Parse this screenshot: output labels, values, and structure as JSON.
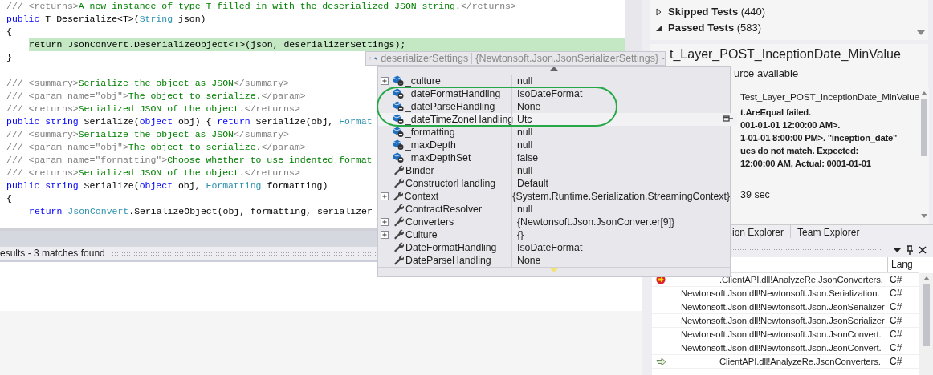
{
  "editor": {
    "blocks": [
      [
        {
          "indented": false,
          "highlight": false,
          "tokens": [
            {
              "kind": "doc",
              "text": "/// <returns>"
            },
            {
              "kind": "doc-text",
              "text": "A new instance of type T filled in with the deserialized JSON string."
            },
            {
              "kind": "doc",
              "text": "</returns>"
            }
          ]
        },
        {
          "indented": false,
          "highlight": false,
          "tokens": [
            {
              "kind": "kw",
              "text": "public"
            },
            {
              "kind": "text",
              "text": " T Deserialize<T>("
            },
            {
              "kind": "type",
              "text": "String"
            },
            {
              "kind": "text",
              "text": " json)"
            }
          ]
        },
        {
          "indented": false,
          "highlight": false,
          "tokens": [
            {
              "kind": "text",
              "text": "{"
            }
          ]
        },
        {
          "indented": true,
          "highlight": true,
          "tokens": [
            {
              "kind": "text",
              "text": "return JsonConvert.DeserializeObject<T>(json, deserializerSettings);"
            }
          ]
        },
        {
          "indented": false,
          "highlight": false,
          "tokens": [
            {
              "kind": "text",
              "text": "}"
            }
          ]
        }
      ],
      [
        {
          "indented": false,
          "highlight": false,
          "tokens": [
            {
              "kind": "doc",
              "text": "/// <summary>"
            },
            {
              "kind": "doc-text",
              "text": "Serialize the object as JSON"
            },
            {
              "kind": "doc",
              "text": "</summary>"
            }
          ]
        },
        {
          "indented": false,
          "highlight": false,
          "tokens": [
            {
              "kind": "doc",
              "text": "/// <param name=\"obj\">"
            },
            {
              "kind": "doc-text",
              "text": "The object to serialize."
            },
            {
              "kind": "doc",
              "text": "</param>"
            }
          ]
        },
        {
          "indented": false,
          "highlight": false,
          "tokens": [
            {
              "kind": "doc",
              "text": "/// <returns>"
            },
            {
              "kind": "doc-text",
              "text": "Serialized JSON of the object."
            },
            {
              "kind": "doc",
              "text": "</returns>"
            }
          ]
        },
        {
          "indented": false,
          "highlight": false,
          "tokens": [
            {
              "kind": "kw",
              "text": "public string"
            },
            {
              "kind": "text",
              "text": " Serialize("
            },
            {
              "kind": "kw",
              "text": "object"
            },
            {
              "kind": "text",
              "text": " obj) { "
            },
            {
              "kind": "kw",
              "text": "return"
            },
            {
              "kind": "text",
              "text": " Serialize(obj, "
            },
            {
              "kind": "type",
              "text": "Format"
            }
          ]
        },
        {
          "indented": false,
          "highlight": false,
          "tokens": [
            {
              "kind": "doc",
              "text": "/// <summary>"
            },
            {
              "kind": "doc-text",
              "text": "Serialize the object as JSON"
            },
            {
              "kind": "doc",
              "text": "</summary>"
            }
          ]
        },
        {
          "indented": false,
          "highlight": false,
          "tokens": [
            {
              "kind": "doc",
              "text": "/// <param name=\"obj\">"
            },
            {
              "kind": "doc-text",
              "text": "The object to serialize."
            },
            {
              "kind": "doc",
              "text": "</param>"
            }
          ]
        },
        {
          "indented": false,
          "highlight": false,
          "tokens": [
            {
              "kind": "doc",
              "text": "/// <param name=\"formatting\">"
            },
            {
              "kind": "doc-text",
              "text": "Choose whether to use indented format"
            }
          ]
        },
        {
          "indented": false,
          "highlight": false,
          "tokens": [
            {
              "kind": "doc",
              "text": "/// <returns>"
            },
            {
              "kind": "doc-text",
              "text": "Serialized JSON of the object."
            },
            {
              "kind": "doc",
              "text": "</returns>"
            }
          ]
        },
        {
          "indented": false,
          "highlight": false,
          "tokens": [
            {
              "kind": "kw",
              "text": "public string"
            },
            {
              "kind": "text",
              "text": " Serialize("
            },
            {
              "kind": "kw",
              "text": "object"
            },
            {
              "kind": "text",
              "text": " obj, "
            },
            {
              "kind": "type",
              "text": "Formatting"
            },
            {
              "kind": "text",
              "text": " formatting)"
            }
          ]
        },
        {
          "indented": false,
          "highlight": false,
          "tokens": [
            {
              "kind": "text",
              "text": "{"
            }
          ]
        },
        {
          "indented": true,
          "highlight": false,
          "tokens": [
            {
              "kind": "kw",
              "text": "return"
            },
            {
              "kind": "type",
              "text": " JsonConvert"
            },
            {
              "kind": "text",
              "text": ".SerializeObject(obj, formatting, serializer"
            }
          ]
        }
      ]
    ]
  },
  "find_results": {
    "title": "esults - 3 matches found"
  },
  "test_explorer": {
    "groups": [
      {
        "label": "Skipped Tests",
        "count": "(440)",
        "expanded": false
      },
      {
        "label": "Passed Tests",
        "count": "(583)",
        "expanded": true
      }
    ],
    "detail": {
      "title": "t_Layer_POST_InceptionDate_MinValue",
      "source": "urce available",
      "messages": [
        {
          "kind": "name",
          "text": "Test_Layer_POST_InceptionDate_MinValue"
        },
        {
          "kind": "error",
          "text": "t.AreEqual failed."
        },
        {
          "kind": "error",
          "text": "001-01-01 12:00:00 AM>."
        },
        {
          "kind": "error",
          "text": "1-01-01 8:00:00 PM>. \"inception_date\""
        },
        {
          "kind": "error",
          "text": "ues do not match. Expected:"
        },
        {
          "kind": "error",
          "text": "12:00:00 AM, Actual: 0001-01-01"
        },
        {
          "kind": "duration",
          "text": "39 sec"
        }
      ]
    },
    "tabs": [
      {
        "label": "ion Explorer",
        "selected": false
      },
      {
        "label": "Team Explorer",
        "selected": false
      }
    ]
  },
  "call_stack": {
    "columns": [
      "Lang"
    ],
    "rows": [
      {
        "kind": "current",
        "function": ".ClientAPI.dll!AnalyzeRe.JsonConverters.",
        "language": "C#"
      },
      {
        "kind": "frame",
        "function": "Newtonsoft.Json.dll!Newtonsoft.Json.Serialization.",
        "language": "C#"
      },
      {
        "kind": "frame",
        "function": "Newtonsoft.Json.dll!Newtonsoft.Json.JsonSerializer",
        "language": "C#"
      },
      {
        "kind": "frame",
        "function": "Newtonsoft.Json.dll!Newtonsoft.Json.JsonSerializer",
        "language": "C#"
      },
      {
        "kind": "frame",
        "function": "Newtonsoft.Json.dll!Newtonsoft.Json.JsonConvert.",
        "language": "C#"
      },
      {
        "kind": "frame",
        "function": "Newtonsoft.Json.dll!Newtonsoft.Json.JsonConvert.",
        "language": "C#"
      },
      {
        "kind": "caller",
        "function": "ClientAPI.dll!AnalyzeRe.JsonConverters.",
        "language": "C#"
      }
    ]
  },
  "datatip": {
    "name": "deserializerSettings",
    "type": "{Newtonsoft.Json.JsonSerializerSettings}",
    "rows": [
      {
        "kind": "field",
        "name": "_culture",
        "value": "null",
        "expandable": true,
        "hovered": false
      },
      {
        "kind": "field",
        "name": "_dateFormatHandling",
        "value": "IsoDateFormat",
        "expandable": false,
        "hovered": false
      },
      {
        "kind": "field",
        "name": "_dateParseHandling",
        "value": "None",
        "expandable": false,
        "hovered": false
      },
      {
        "kind": "field",
        "name": "_dateTimeZoneHandling",
        "value": "Utc",
        "expandable": false,
        "hovered": true
      },
      {
        "kind": "field",
        "name": "_formatting",
        "value": "null",
        "expandable": false,
        "hovered": false
      },
      {
        "kind": "field",
        "name": "_maxDepth",
        "value": "null",
        "expandable": false,
        "hovered": false
      },
      {
        "kind": "field",
        "name": "_maxDepthSet",
        "value": "false",
        "expandable": false,
        "hovered": false
      },
      {
        "kind": "property",
        "name": "Binder",
        "value": "null",
        "expandable": false,
        "hovered": false
      },
      {
        "kind": "property",
        "name": "ConstructorHandling",
        "value": "Default",
        "expandable": false,
        "hovered": false
      },
      {
        "kind": "property",
        "name": "Context",
        "value": "{System.Runtime.Serialization.StreamingContext}",
        "expandable": true,
        "hovered": false
      },
      {
        "kind": "property",
        "name": "ContractResolver",
        "value": "null",
        "expandable": false,
        "hovered": false
      },
      {
        "kind": "property",
        "name": "Converters",
        "value": "{Newtonsoft.Json.JsonConverter[9]}",
        "expandable": true,
        "hovered": false
      },
      {
        "kind": "property",
        "name": "Culture",
        "value": "{}",
        "expandable": true,
        "hovered": false
      },
      {
        "kind": "property",
        "name": "DateFormatHandling",
        "value": "IsoDateFormat",
        "expandable": false,
        "hovered": false
      },
      {
        "kind": "property",
        "name": "DateParseHandling",
        "value": "None",
        "expandable": false,
        "hovered": false
      }
    ]
  }
}
